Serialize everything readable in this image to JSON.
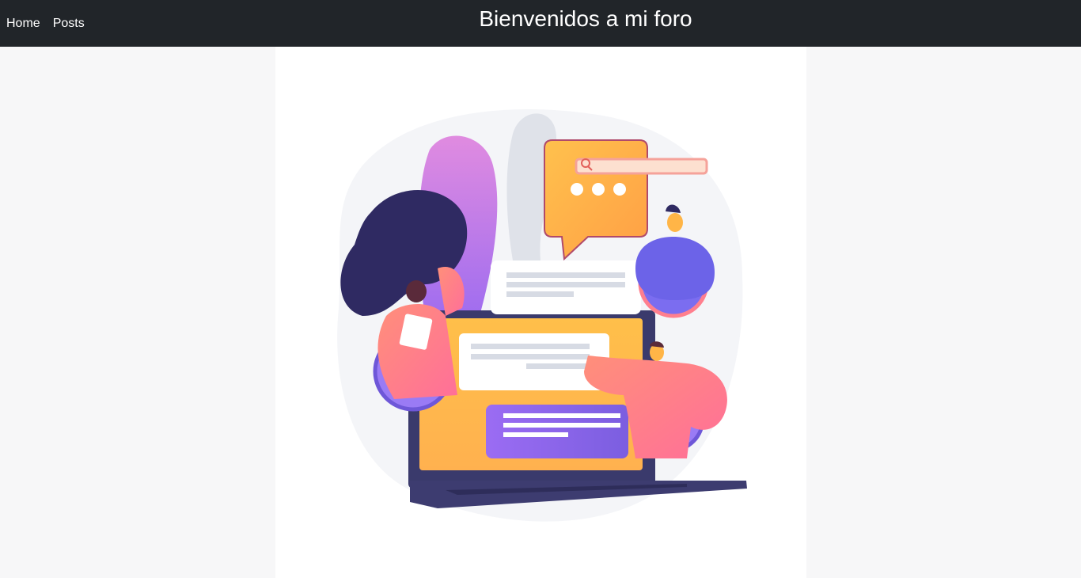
{
  "nav": {
    "links": [
      {
        "label": "Home"
      },
      {
        "label": "Posts"
      }
    ],
    "title": "Bienvenidos a mi foro"
  },
  "hero": {
    "image": "forum-community-illustration",
    "colors": {
      "navbar_bg": "#212529",
      "page_bg": "#f7f7f8",
      "orange": "#ffb547",
      "pink": "#ff7f8e",
      "purple": "#8b6cf0",
      "navy": "#3b3a6e"
    }
  }
}
